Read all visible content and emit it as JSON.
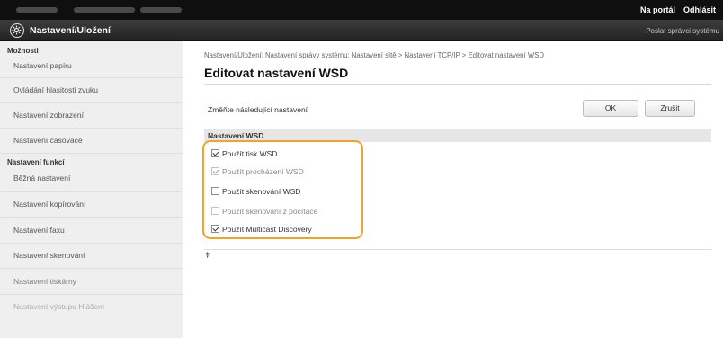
{
  "header": {
    "portal_link": "Na portál",
    "logout_link": "Odhlásit",
    "title": "Nastavení/Uložení",
    "right_link": "Poslat správci systému"
  },
  "sidebar": {
    "sections": [
      {
        "heading": "Možnosti",
        "items": [
          "Nastavení papíru",
          "Ovládání hlasitosti zvuku",
          "Nastavení zobrazení",
          "Nastavení časovače"
        ]
      },
      {
        "heading": "Nastavení funkcí",
        "items": [
          "Běžná nastavení",
          "Nastavení kopírování",
          "Nastavení faxu",
          "Nastavení skenování",
          "Nastavení tiskárny",
          "Nastavení výstupu Hlášení"
        ]
      }
    ]
  },
  "main": {
    "breadcrumb": "Nastavení/Uložení: Nastavení správy systému: Nastavení sítě > Nastavení TCP/IP > Editovat nastavení WSD",
    "title": "Editovat nastavení WSD",
    "instruction": "Změňte následující nastavení",
    "ok_label": "OK",
    "cancel_label": "Zrušit",
    "section_title": "Nastavení WSD",
    "options": [
      {
        "label": "Použít tisk WSD",
        "checked": true,
        "disabled": false
      },
      {
        "label": "Použít procházení WSD",
        "checked": true,
        "disabled": true
      },
      {
        "label": "Použít skenování WSD",
        "checked": false,
        "disabled": false
      },
      {
        "label": "Použít skenování z počítače",
        "checked": false,
        "disabled": true
      },
      {
        "label": "Použít Multicast Discovery",
        "checked": true,
        "disabled": false
      }
    ],
    "top_arrow": "⍒"
  },
  "colors": {
    "highlight": "#f2a32e",
    "topbar": "#0f0f0f",
    "titlebar": "#2d2d2d"
  }
}
